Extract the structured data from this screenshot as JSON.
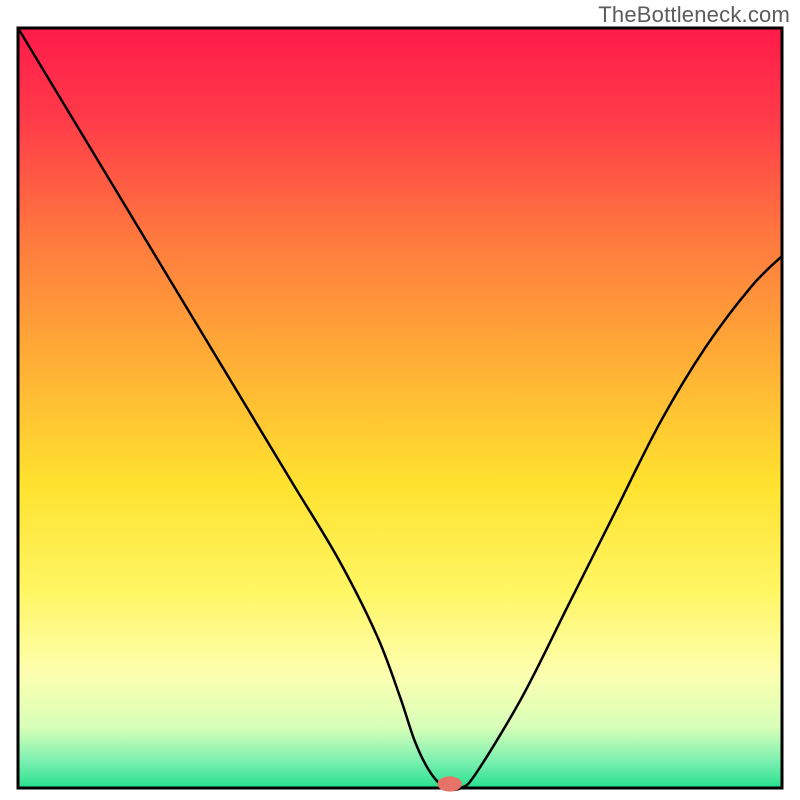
{
  "watermark": "TheBottleneck.com",
  "chart_data": {
    "type": "line",
    "title": "",
    "xlabel": "",
    "ylabel": "",
    "xlim": [
      0,
      100
    ],
    "ylim": [
      0,
      100
    ],
    "grid": false,
    "legend": false,
    "background_gradient": {
      "stops": [
        {
          "offset": 0.0,
          "color": "#ff1a4a"
        },
        {
          "offset": 0.12,
          "color": "#ff3b49"
        },
        {
          "offset": 0.28,
          "color": "#ff7a3e"
        },
        {
          "offset": 0.45,
          "color": "#ffb235"
        },
        {
          "offset": 0.6,
          "color": "#ffe22f"
        },
        {
          "offset": 0.74,
          "color": "#fff663"
        },
        {
          "offset": 0.85,
          "color": "#fdffb0"
        },
        {
          "offset": 0.92,
          "color": "#d8ffb8"
        },
        {
          "offset": 0.965,
          "color": "#7af0b0"
        },
        {
          "offset": 1.0,
          "color": "#27e08f"
        }
      ]
    },
    "series": [
      {
        "name": "bottleneck-curve",
        "x": [
          0,
          6,
          12,
          18,
          24,
          30,
          36,
          42,
          47,
          50,
          52,
          54,
          56,
          58,
          60,
          66,
          72,
          78,
          84,
          90,
          96,
          100
        ],
        "y": [
          100,
          90,
          80,
          70,
          60,
          50,
          40,
          30,
          20,
          12,
          6,
          2,
          0,
          0,
          2,
          12,
          24,
          36,
          48,
          58,
          66,
          70
        ]
      }
    ],
    "marker": {
      "name": "current-point",
      "x": 56.5,
      "y": 0,
      "rx": 1.6,
      "ry": 1.0,
      "color": "#e57368"
    }
  }
}
